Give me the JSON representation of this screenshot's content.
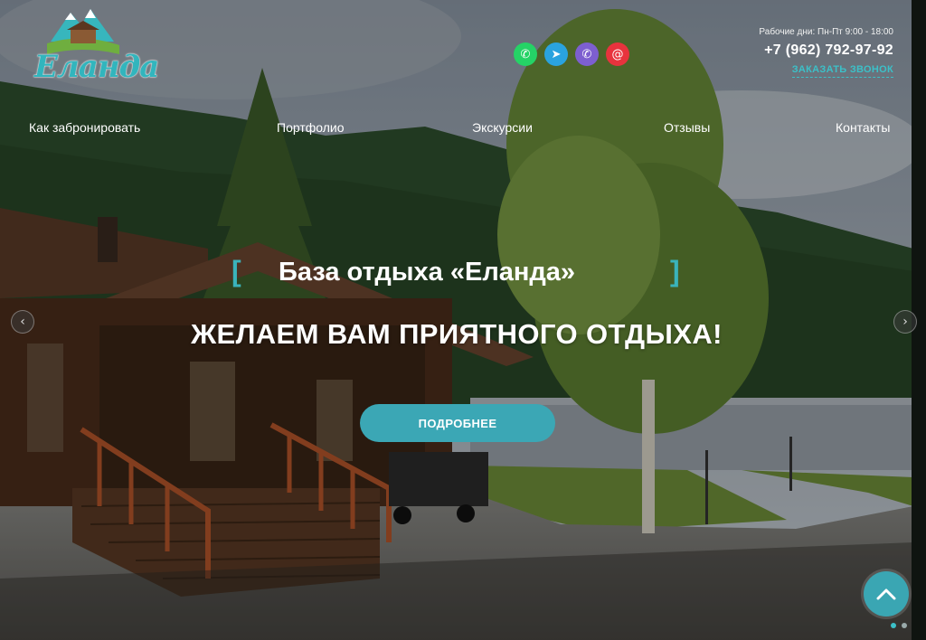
{
  "brand": {
    "logo_text": "Еланда"
  },
  "header": {
    "social": [
      {
        "name": "whatsapp",
        "icon": "whatsapp-icon",
        "color": "#25d366",
        "glyph": "✆"
      },
      {
        "name": "telegram",
        "icon": "telegram-icon",
        "color": "#2aa3df",
        "glyph": "➤"
      },
      {
        "name": "viber",
        "icon": "viber-icon",
        "color": "#7d5fd0",
        "glyph": "✆"
      },
      {
        "name": "email",
        "icon": "at-sign-icon",
        "color": "#e8333d",
        "glyph": "@"
      }
    ],
    "hours": "Рабочие дни: Пн-Пт 9:00 - 18:00",
    "phone": "+7 (962) 792-97-92",
    "callback_label": "ЗАКАЗАТЬ ЗВОНОК"
  },
  "nav": {
    "items": [
      {
        "label": "Как забронировать"
      },
      {
        "label": "Портфолио"
      },
      {
        "label": "Экскурсии"
      },
      {
        "label": "Отзывы"
      },
      {
        "label": "Контакты"
      }
    ]
  },
  "slide": {
    "bracket_left": "[",
    "bracket_right": "]",
    "title": "База отдыха «Еланда»",
    "subtitle": "ЖЕЛАЕМ ВАМ ПРИЯТНОГО ОТДЫХА!",
    "button_label": "ПОДРОБНЕЕ"
  },
  "slider": {
    "prev_glyph": "‹",
    "next_glyph": "›",
    "slide_count": 2,
    "active_index": 0
  },
  "colors": {
    "accent": "#3ba7b5",
    "link": "#3cc0c8"
  }
}
